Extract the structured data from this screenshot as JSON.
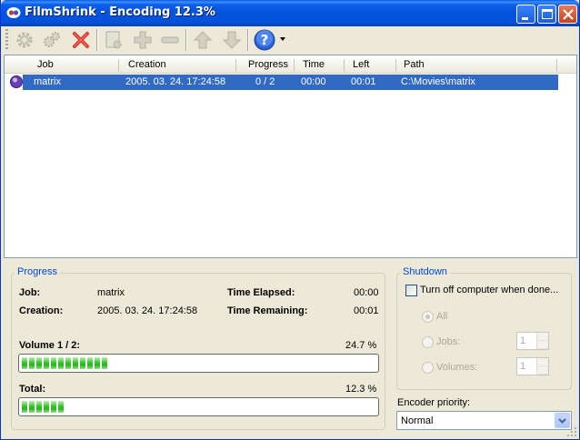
{
  "window": {
    "title": "FilmShrink - Encoding 12.3%"
  },
  "toolbar": {
    "buttons": [
      {
        "name": "settings-icon"
      },
      {
        "name": "batch-settings-icon"
      },
      {
        "name": "delete-icon"
      },
      {
        "name": "new-job-icon"
      },
      {
        "name": "add-icon"
      },
      {
        "name": "remove-icon"
      },
      {
        "name": "move-up-icon"
      },
      {
        "name": "move-down-icon"
      },
      {
        "name": "help-icon"
      }
    ]
  },
  "jobs": {
    "columns": [
      "Job",
      "Creation",
      "Progress",
      "Time",
      "Left",
      "Path"
    ],
    "rows": [
      {
        "job": "matrix",
        "creation": "2005. 03. 24. 17:24:58",
        "progress": "0 / 2",
        "time": "00:00",
        "left": "00:01",
        "path": "C:\\Movies\\matrix"
      }
    ]
  },
  "progress": {
    "title": "Progress",
    "job_label": "Job:",
    "job_value": "matrix",
    "creation_label": "Creation:",
    "creation_value": "2005. 03. 24. 17:24:58",
    "elapsed_label": "Time Elapsed:",
    "elapsed_value": "00:00",
    "remaining_label": "Time Remaining:",
    "remaining_value": "00:01",
    "volume_label": "Volume 1 / 2:",
    "volume_percent": "24.7 %",
    "volume_fraction": 0.247,
    "total_label": "Total:",
    "total_percent": "12.3 %",
    "total_fraction": 0.123
  },
  "shutdown": {
    "title": "Shutdown",
    "turn_off_label": "Turn off computer when done...",
    "all_label": "All",
    "jobs_label": "Jobs:",
    "jobs_value": "1",
    "volumes_label": "Volumes:",
    "volumes_value": "1"
  },
  "encoder": {
    "label": "Encoder priority:",
    "value": "Normal"
  },
  "colors": {
    "selection": "#316ac5",
    "group_title": "#0046d5",
    "progress_green": "#35c62a"
  }
}
